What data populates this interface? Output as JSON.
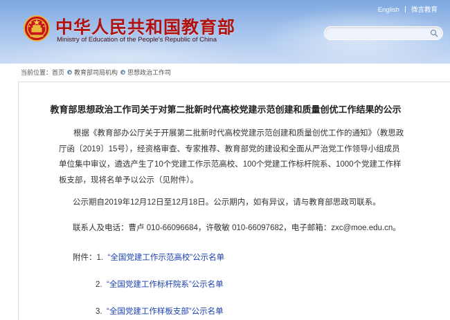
{
  "header": {
    "logo_cn": "中华人民共和国教育部",
    "logo_en": "Ministry of Education of the People's Republic of China",
    "links": [
      "English",
      "微言教育"
    ],
    "search_placeholder": ""
  },
  "breadcrumb": {
    "label": "当前位置：",
    "items": [
      "首页",
      "教育部司局机构",
      "思想政治工作司"
    ]
  },
  "article": {
    "title": "教育部思想政治工作司关于对第二批新时代高校党建示范创建和质量创优工作结果的公示",
    "paragraph1": "根据《教育部办公厅关于开展第二批新时代高校党建示范创建和质量创优工作的通知》（教思政厅函〔2019〕15号），经资格审查、专家推荐、教育部党的建设和全面从严治党工作领导小组成员单位集中审议，遴选产生了10个党建工作示范高校、100个党建工作标杆院系、1000个党建工作样板支部，现将名单予以公示（见附件）。",
    "paragraph2": "公示期自2019年12月12日至12月18日。公示期内，如有异议，请与教育部思政司联系。",
    "paragraph3": "联系人及电话：曹卢 010-66096684，许敬敏 010-66097682，电子邮箱：zxc@moe.edu.cn。",
    "attachments_label": "附件：",
    "attachments": [
      {
        "num": "1.",
        "text": "“全国党建工作示范高校”公示名单"
      },
      {
        "num": "2.",
        "text": "“全国党建工作标杆院系”公示名单"
      },
      {
        "num": "3.",
        "text": "“全国党建工作样板支部”公示名单"
      }
    ]
  },
  "colors": {
    "logo_red": "#b0120f",
    "header_blue": "#7ea8e0",
    "link_blue": "#1a3fb0"
  }
}
